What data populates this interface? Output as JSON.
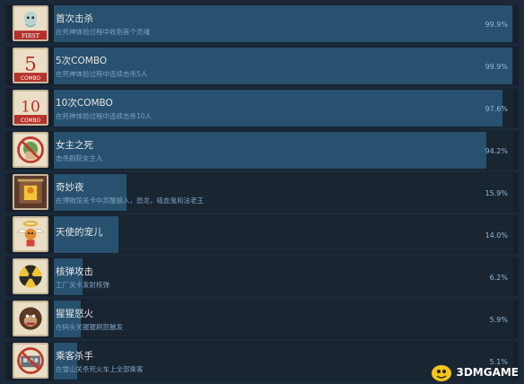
{
  "achievements": [
    {
      "title": "首次击杀",
      "desc": "在死神体验过程中收割首个灵魂",
      "percent": "99.9%",
      "fill": 0.999,
      "badge": "FIRST",
      "icon": "first-kill-badge-icon"
    },
    {
      "title": "5次COMBO",
      "desc": "在死神体验过程中连续击杀5人",
      "percent": "99.9%",
      "fill": 0.999,
      "badge_num": "5",
      "badge": "COMBO",
      "icon": "combo-5-badge-icon"
    },
    {
      "title": "10次COMBO",
      "desc": "在死神体验过程中连续击杀10人",
      "percent": "97.6%",
      "fill": 0.976,
      "badge_num": "10",
      "badge": "COMBO",
      "icon": "combo-10-badge-icon"
    },
    {
      "title": "女主之死",
      "desc": "击杀剧院女主人",
      "percent": "94.2%",
      "fill": 0.942,
      "icon": "no-woman-icon"
    },
    {
      "title": "奇妙夜",
      "desc": "在博物馆关卡中苏醒狼人，恐龙，吸血鬼和法老王",
      "percent": "15.9%",
      "fill": 0.159,
      "icon": "museum-night-icon"
    },
    {
      "title": "天使的宠儿",
      "desc": "",
      "percent": "14.0%",
      "fill": 0.14,
      "icon": "angel-icon"
    },
    {
      "title": "核弹攻击",
      "desc": "工厂关卡发射核弹",
      "percent": "6.2%",
      "fill": 0.062,
      "icon": "nuclear-icon"
    },
    {
      "title": "猩猩怒火",
      "desc": "在码头关猩猩刷怒触发",
      "percent": "5.9%",
      "fill": 0.059,
      "icon": "gorilla-icon"
    },
    {
      "title": "乘客杀手",
      "desc": "在雪山关杀死火车上全部乘客",
      "percent": "5.1%",
      "fill": 0.051,
      "icon": "no-train-icon"
    }
  ],
  "watermark": {
    "text": "3DMGAME",
    "icon": "3dm-logo-icon"
  }
}
